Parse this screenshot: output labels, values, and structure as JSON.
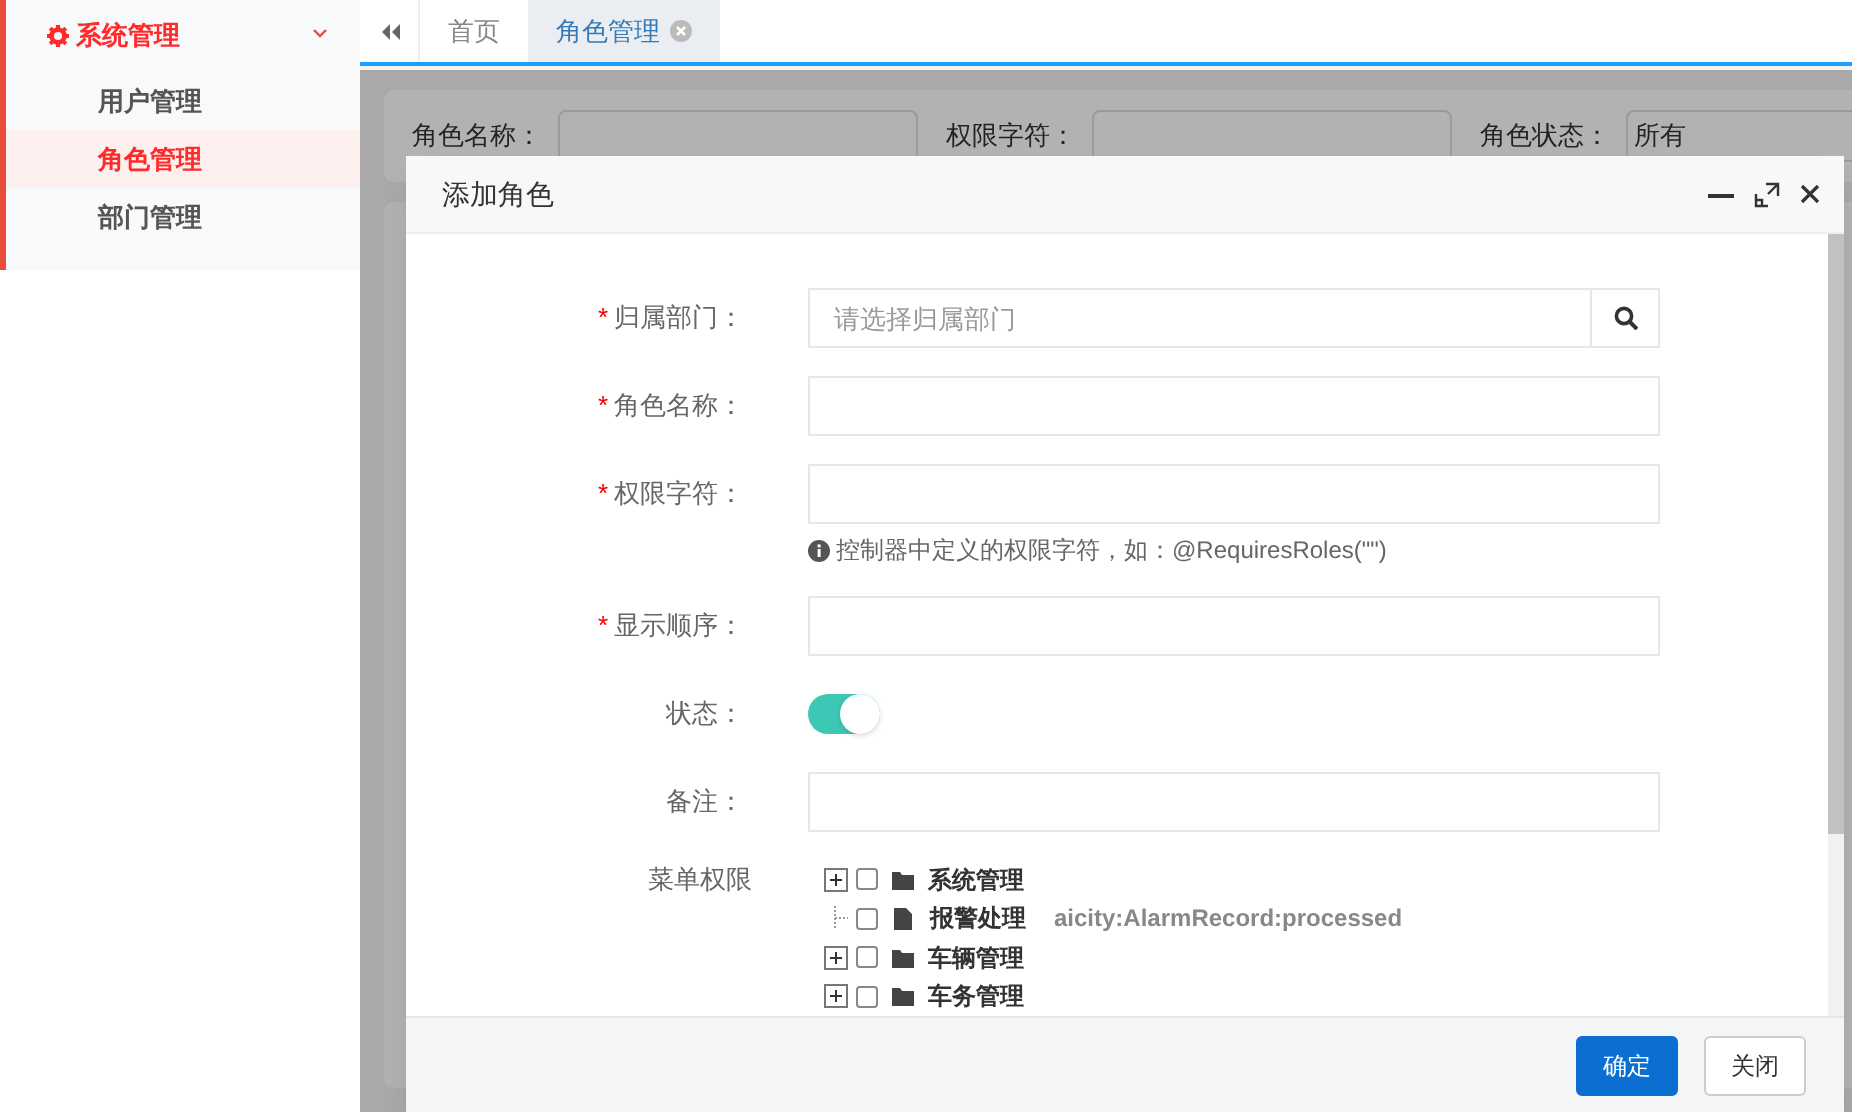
{
  "sidebar": {
    "group": {
      "label": "系统管理",
      "expanded": true
    },
    "items": [
      {
        "label": "用户管理",
        "selected": false
      },
      {
        "label": "角色管理",
        "selected": true
      },
      {
        "label": "部门管理",
        "selected": false
      }
    ]
  },
  "tabs": [
    {
      "label": "首页",
      "selected": false,
      "closable": false
    },
    {
      "label": "角色管理",
      "selected": true,
      "closable": true
    }
  ],
  "search_form": {
    "fields": [
      {
        "label": "角色名称："
      },
      {
        "label": "权限字符："
      },
      {
        "label": "角色状态：",
        "value": "所有"
      }
    ]
  },
  "dialog": {
    "title": "添加角色",
    "form": [
      {
        "kind": "search",
        "required_mark": "*",
        "label": "归属部门：",
        "placeholder": "请选择归属部门"
      },
      {
        "kind": "text",
        "required_mark": "*",
        "label": "角色名称："
      },
      {
        "kind": "text",
        "required_mark": "*",
        "label": "权限字符：",
        "help": "控制器中定义的权限字符，如：@RequiresRoles(\"\")"
      },
      {
        "kind": "text",
        "required_mark": "*",
        "label": "显示顺序："
      },
      {
        "kind": "switch",
        "label": "状态：",
        "on": true
      },
      {
        "kind": "text",
        "label": "备注："
      },
      {
        "kind": "tree",
        "label": "菜单权限",
        "nodes": [
          {
            "kind": "folder",
            "label": "系统管理",
            "expanded": false,
            "checked": false
          },
          {
            "kind": "file",
            "label": "报警处理",
            "checked": false,
            "permission": "aicity:AlarmRecord:processed"
          },
          {
            "kind": "folder",
            "label": "车辆管理",
            "expanded": false,
            "checked": false
          },
          {
            "kind": "folder",
            "label": "车务管理",
            "expanded": false,
            "checked": false
          }
        ]
      }
    ],
    "buttons": [
      {
        "kind": "primary",
        "label": "确定"
      },
      {
        "kind": "default",
        "label": "关闭"
      }
    ]
  }
}
